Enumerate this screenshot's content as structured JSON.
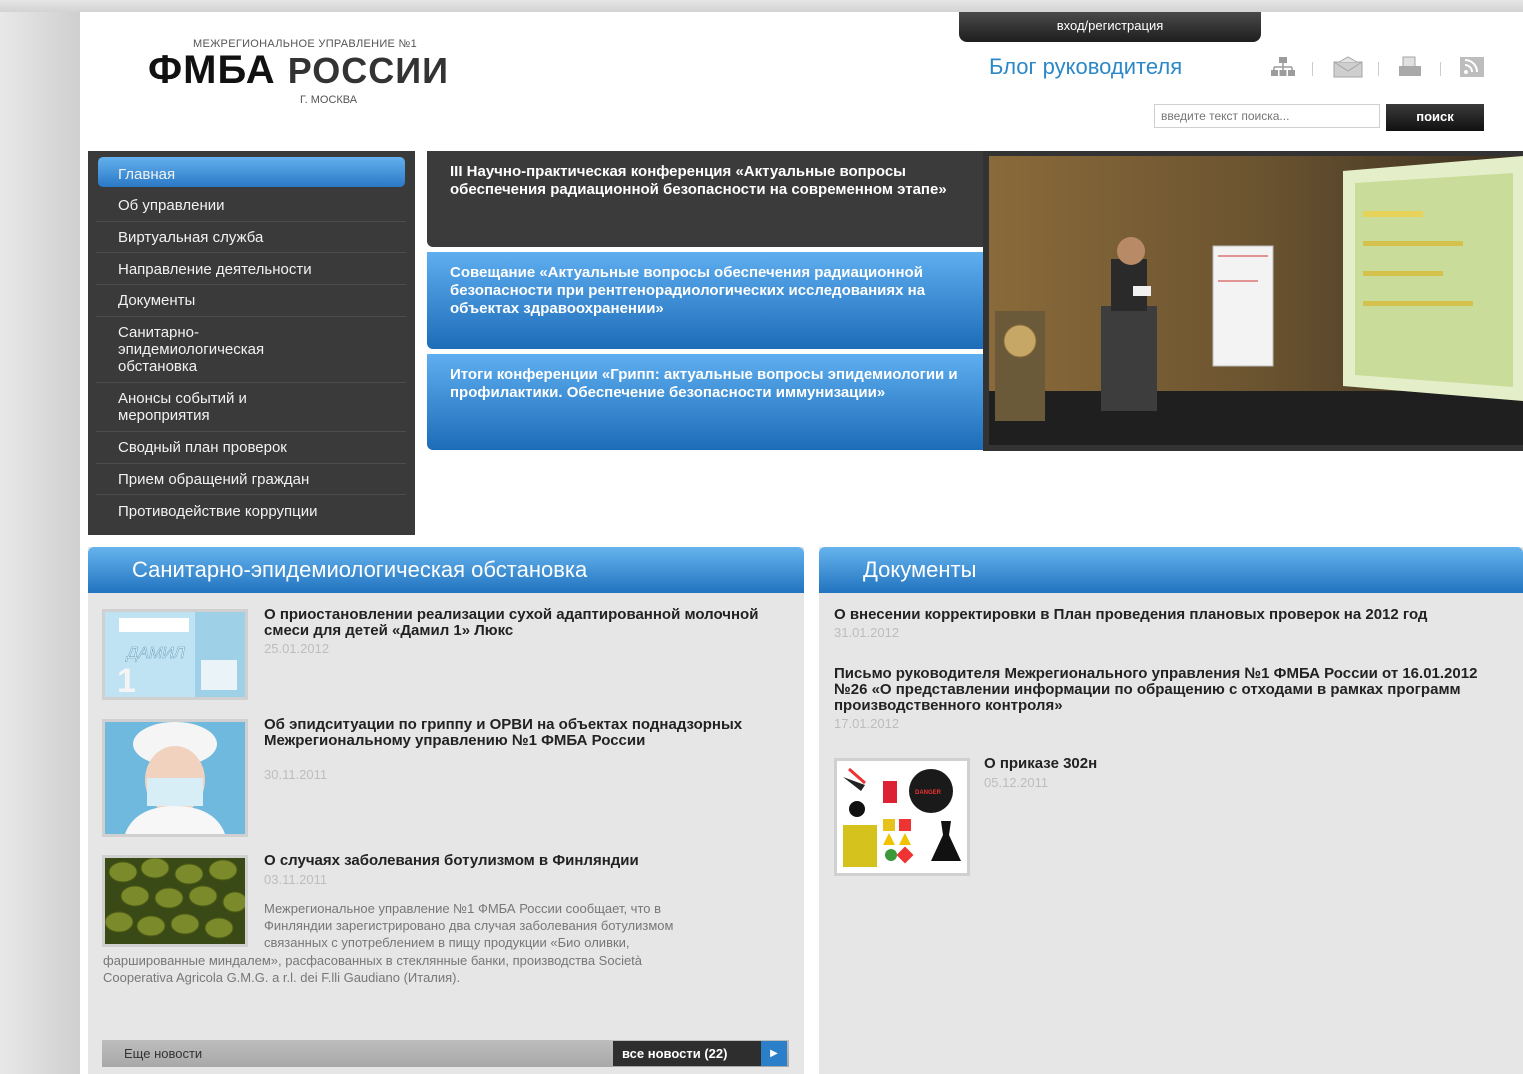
{
  "header": {
    "org_top": "МЕЖРЕГИОНАЛЬНОЕ УПРАВЛЕНИЕ №1",
    "logo_main": "ФМБА",
    "logo_sub": "РОССИИ",
    "city": "Г. МОСКВА",
    "login": "вход/регистрация",
    "blog": "Блог руководителя",
    "search_placeholder": "введите текст поиска...",
    "search_button": "поиск"
  },
  "nav": {
    "items": [
      "Главная",
      "Об управлении",
      "Виртуальная служба",
      "Направление деятельности",
      "Документы",
      "Санитарно-эпидемиологическая обстановка",
      "Анонсы событий и мероприятия",
      "Сводный план проверок",
      "Прием обращений граждан",
      "Противодействие коррупции"
    ],
    "active_index": 0
  },
  "slider": {
    "items": [
      "III Научно-практическая конференция «Актуальные вопросы обеспечения радиационной безопасности на современном этапе»",
      "Совещание «Актуальные вопросы обеспечения радиационной безопасности при рентгенорадиологических исследованиях на объектах здравоохранении»",
      "Итоги конференции «Грипп: актуальные вопросы эпидемиологии и профилактики. Обеспечение безопасности иммунизации»"
    ]
  },
  "epid": {
    "title": "Санитарно-эпидемиологическая обстановка",
    "items": [
      {
        "title": "О приостановлении реализации сухой адаптированной молочной смеси для детей «Дамил 1» Люкс",
        "date": "25.01.2012",
        "thumb_text": "ДАМИЛ"
      },
      {
        "title": "Об эпидситуации по гриппу и ОРВИ на объектах поднадзорных Межрегиональному управлению №1 ФМБА России",
        "date": "30.11.2011"
      },
      {
        "title": "О случаях заболевания ботулизмом в Финляндии",
        "date": "03.11.2011",
        "body_lines": [
          "Межрегиональное управление №1 ФМБА России сообщает, что в",
          "Финляндии зарегистрировано два случая заболевания ботулизмом",
          "связанных с употреблением в пищу продукции «Био оливки,",
          "фаршированные миндалем», расфасованных в стеклянные банки, производства Società",
          "Cooperativa Agricola G.M.G. a r.l. dei F.lli Gaudiano (Италия)."
        ]
      }
    ],
    "more_label": "Еще новости",
    "all_news": "все новости (22)"
  },
  "docs": {
    "title": "Документы",
    "items": [
      {
        "title": "О внесении корректировки в План проведения плановых проверок на 2012 год",
        "date": "31.01.2012"
      },
      {
        "title": "Письмо руководителя Межрегионального управления №1 ФМБА России от 16.01.2012 №26 «О представлении информации по обращению с отходами в рамках программ производственного контроля»",
        "date": "17.01.2012"
      },
      {
        "title": "О приказе 302н",
        "date": "05.12.2011",
        "thumb_text": "DANGER"
      }
    ]
  },
  "colors": {
    "accent_blue": "#2b88c8",
    "nav_bg": "#3a3a3a",
    "panel_bg": "#e6e6e6"
  }
}
